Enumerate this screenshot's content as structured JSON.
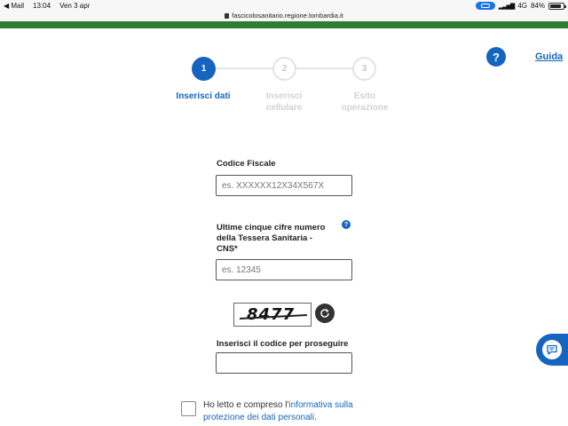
{
  "status_bar": {
    "back_app": "◀ Mail",
    "time": "13:04",
    "date": "Ven 3 apr",
    "url": "fascicolosanitario.regione.lombardia.it",
    "network": "4G",
    "battery": "84%"
  },
  "colors": {
    "brand_green": "#2e7d32",
    "primary_blue": "#1565c0"
  },
  "stepper": {
    "steps": [
      {
        "number": "1",
        "label_line1": "Inserisci dati",
        "label_line2": "",
        "active": true
      },
      {
        "number": "2",
        "label_line1": "Inserisci",
        "label_line2": "cellulare",
        "active": false
      },
      {
        "number": "3",
        "label_line1": "Esito",
        "label_line2": "operazione",
        "active": false
      }
    ]
  },
  "help": {
    "icon": "?",
    "link": "Guida"
  },
  "form": {
    "codice_fiscale": {
      "label": "Codice Fiscale",
      "placeholder": "es. XXXXXX12X34X567X"
    },
    "tessera": {
      "label_line1": "Ultime cinque cifre numero",
      "label_line2": "della Tessera Sanitaria -",
      "label_line3": "CNS*",
      "info_icon": "?",
      "placeholder": "es. 12345"
    },
    "captcha": {
      "text": "8477",
      "label": "Inserisci il codice per proseguire",
      "value": ""
    }
  },
  "consent": {
    "text_before": "Ho letto e compreso l'",
    "link_text": "informativa sulla protezione dei dati personali",
    "text_after": ".",
    "checked": false
  }
}
